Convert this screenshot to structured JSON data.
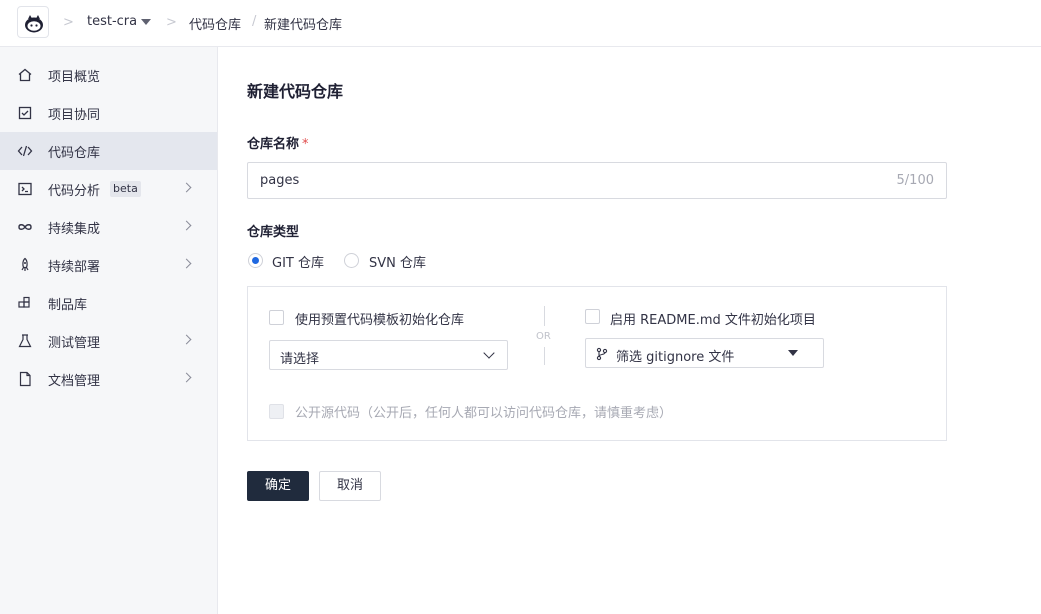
{
  "header": {
    "project": "test-cra",
    "breadcrumb_parent": "代码仓库",
    "breadcrumb_current": "新建代码仓库"
  },
  "sidebar": {
    "items": [
      {
        "label": "项目概览",
        "icon": "home-icon",
        "active": false,
        "expandable": false
      },
      {
        "label": "项目协同",
        "icon": "checkbox-icon",
        "active": false,
        "expandable": false
      },
      {
        "label": "代码仓库",
        "icon": "code-icon",
        "active": true,
        "expandable": false
      },
      {
        "label": "代码分析",
        "icon": "terminal-icon",
        "active": false,
        "expandable": true,
        "badge": "beta"
      },
      {
        "label": "持续集成",
        "icon": "infinity-icon",
        "active": false,
        "expandable": true
      },
      {
        "label": "持续部署",
        "icon": "rocket-icon",
        "active": false,
        "expandable": true
      },
      {
        "label": "制品库",
        "icon": "package-icon",
        "active": false,
        "expandable": false
      },
      {
        "label": "测试管理",
        "icon": "flask-icon",
        "active": false,
        "expandable": true
      },
      {
        "label": "文档管理",
        "icon": "document-icon",
        "active": false,
        "expandable": true
      }
    ]
  },
  "main": {
    "title": "新建代码仓库",
    "name_label": "仓库名称",
    "required_mark": "*",
    "name_value": "pages",
    "name_counter": "5/100",
    "type_label": "仓库类型",
    "type_options": [
      {
        "label": "GIT 仓库",
        "selected": true
      },
      {
        "label": "SVN 仓库",
        "selected": false
      }
    ],
    "template_checkbox": "使用预置代码模板初始化仓库",
    "template_select": "请选择",
    "or_text": "OR",
    "readme_checkbox": "启用 README.md 文件初始化项目",
    "gitignore_select": "筛选 gitignore 文件",
    "public_checkbox": "公开源代码（公开后，任何人都可以访问代码仓库，请慎重考虑）",
    "confirm": "确定",
    "cancel": "取消"
  },
  "colors": {
    "primary_button": "#202b3d",
    "radio_accent": "#1f68e0",
    "required": "#e04c4c",
    "sidebar_bg": "#f6f7f9",
    "sidebar_active": "#e4e7ee"
  }
}
